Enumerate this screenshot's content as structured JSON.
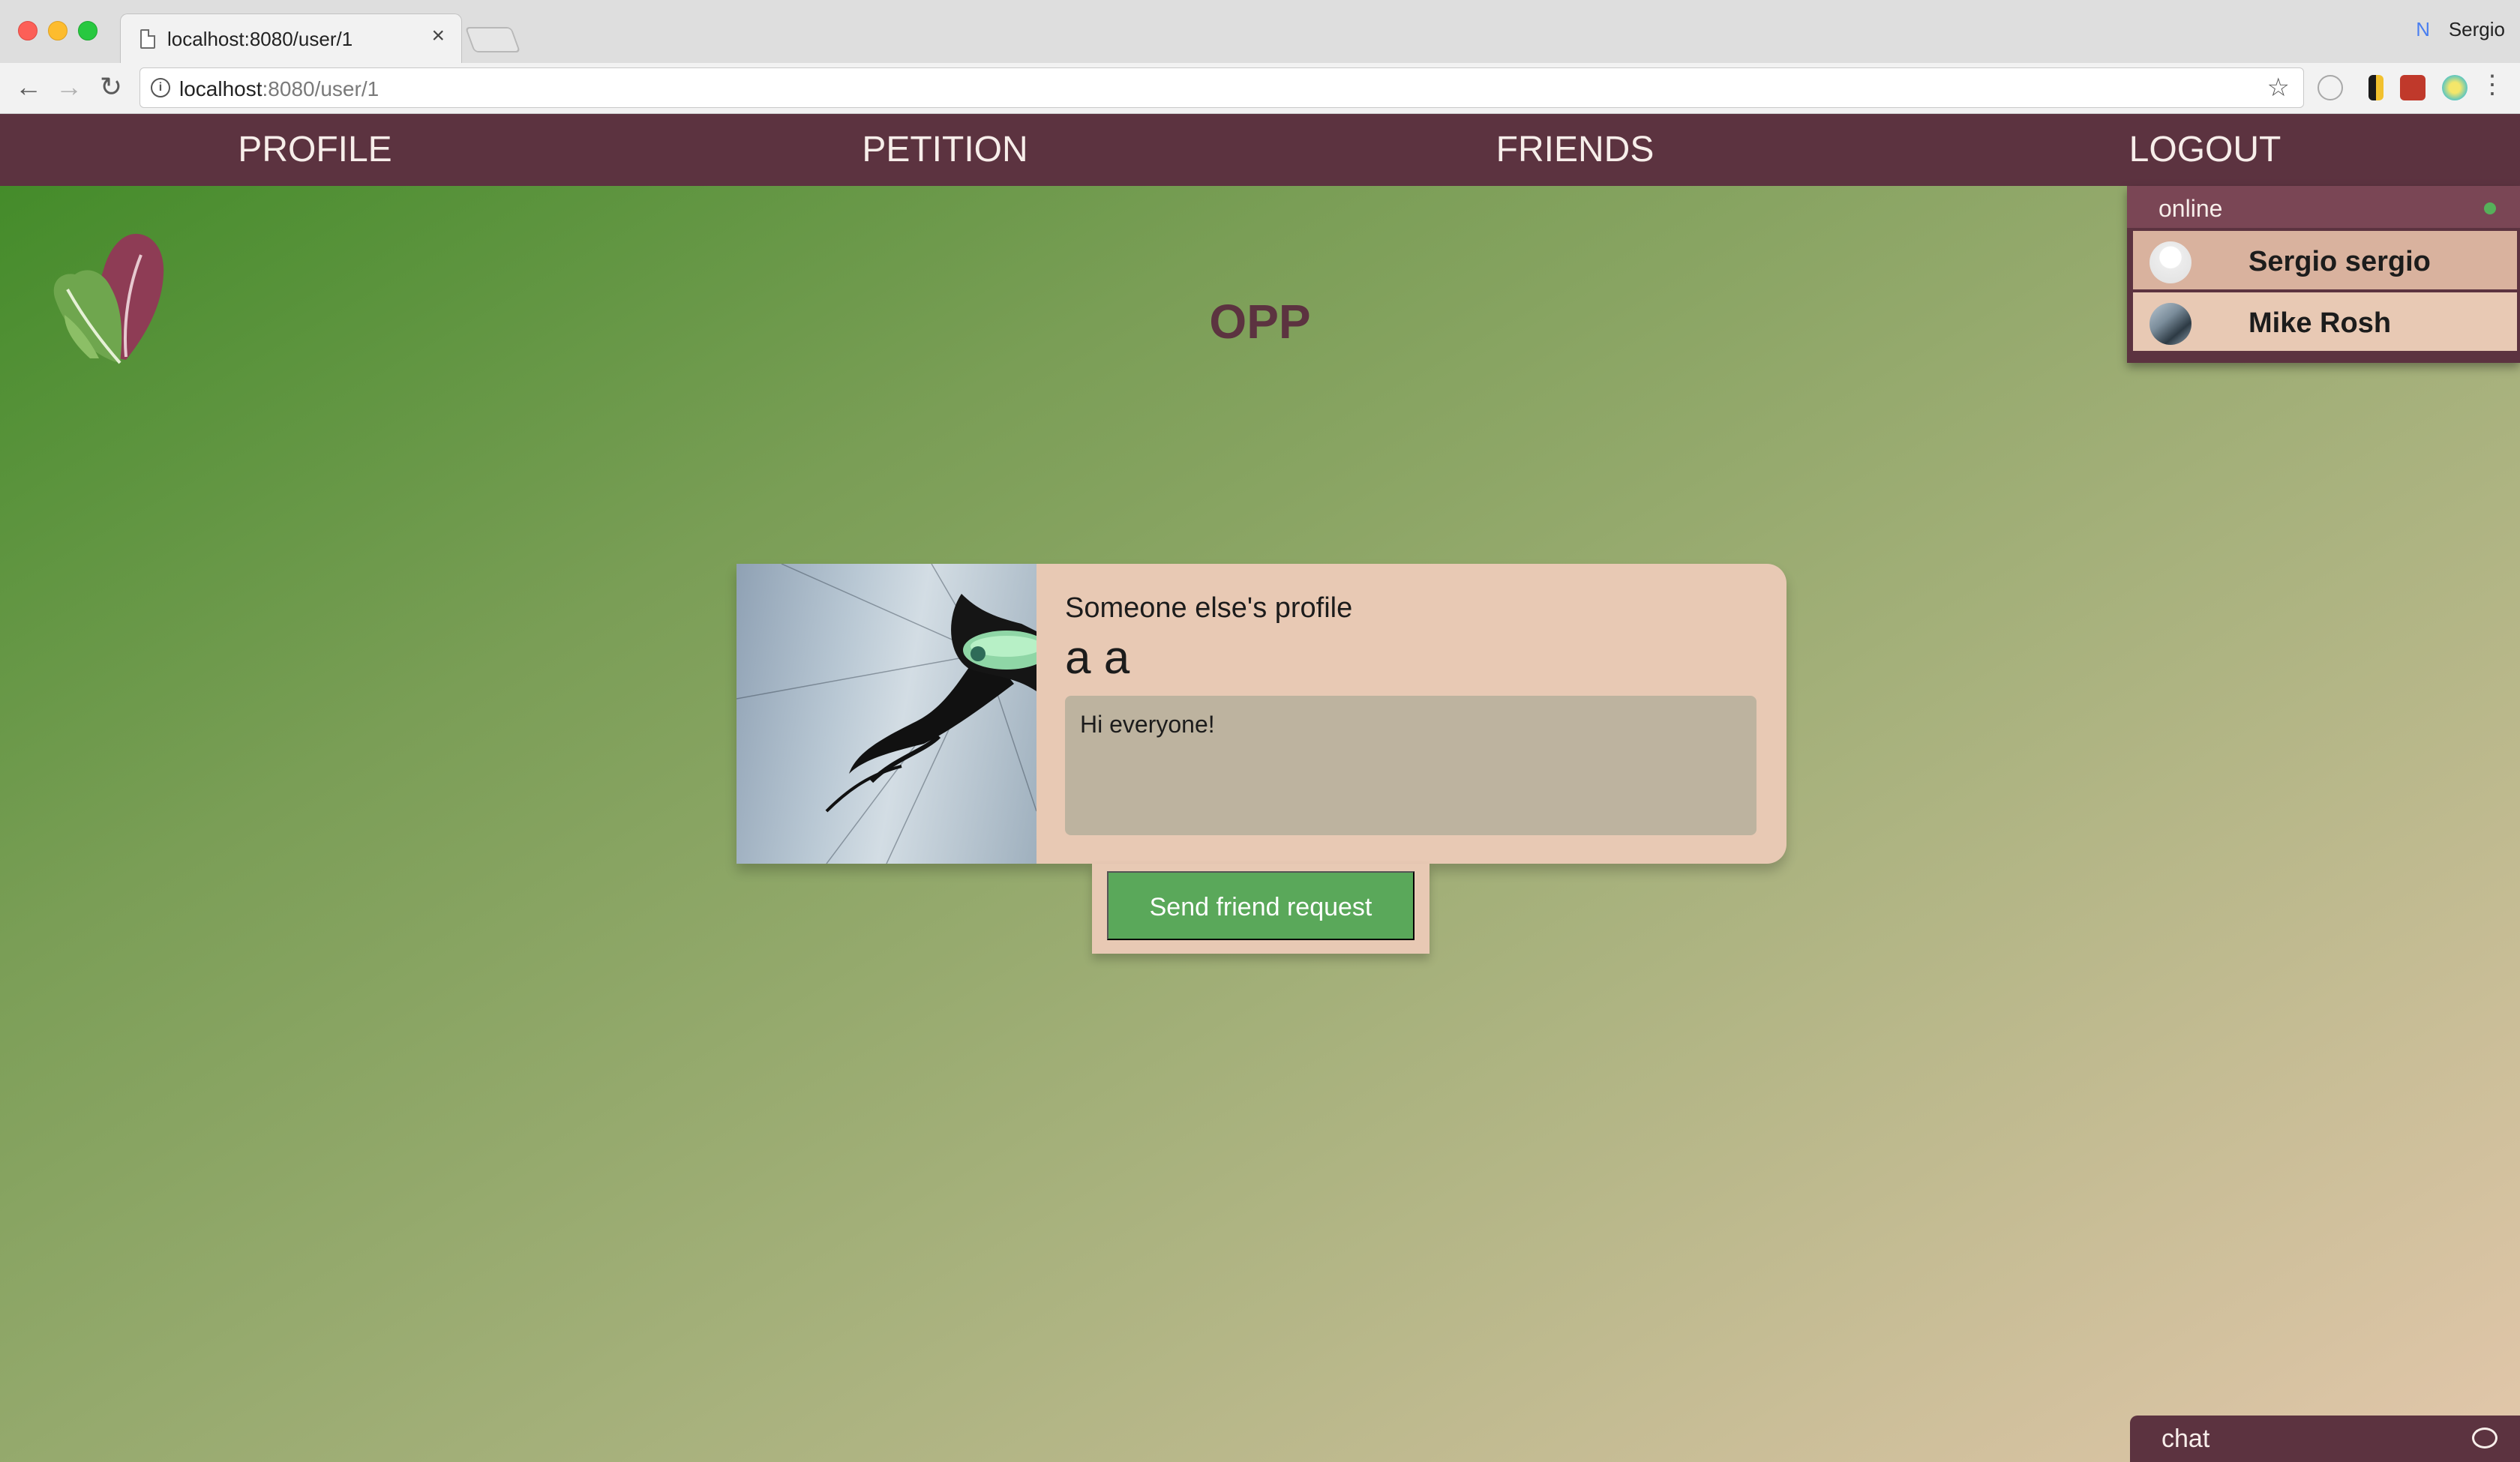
{
  "browser": {
    "tab_title": "localhost:8080/user/1",
    "tab_close": "×",
    "profile_name": "Sergio",
    "profile_icon": "N",
    "url_host": "localhost",
    "url_rest": ":8080/user/1",
    "back_glyph": "←",
    "forward_glyph": "→",
    "reload_glyph": "↻",
    "info_glyph": "i",
    "star_glyph": "☆",
    "menu_glyph": "⋮"
  },
  "nav": {
    "items": [
      {
        "label": "PROFILE"
      },
      {
        "label": "PETITION"
      },
      {
        "label": "FRIENDS"
      },
      {
        "label": "LOGOUT"
      }
    ]
  },
  "page": {
    "title": "OPP"
  },
  "online": {
    "label": "online",
    "users": [
      {
        "name": "Sergio sergio",
        "avatar": "default-avatar-icon"
      },
      {
        "name": "Mike Rosh",
        "avatar": "photo-avatar"
      }
    ]
  },
  "profile": {
    "subtitle": "Someone else's profile",
    "name": "a a",
    "bio": "Hi everyone!",
    "friend_button": "Send friend request"
  },
  "chat": {
    "label": "chat",
    "icon": "speech-bubble-icon"
  },
  "colors": {
    "nav_bg": "#5c3340",
    "card_bg": "#e8c9b4",
    "button_green": "#5aa85a",
    "online_dot": "#56b05a"
  }
}
